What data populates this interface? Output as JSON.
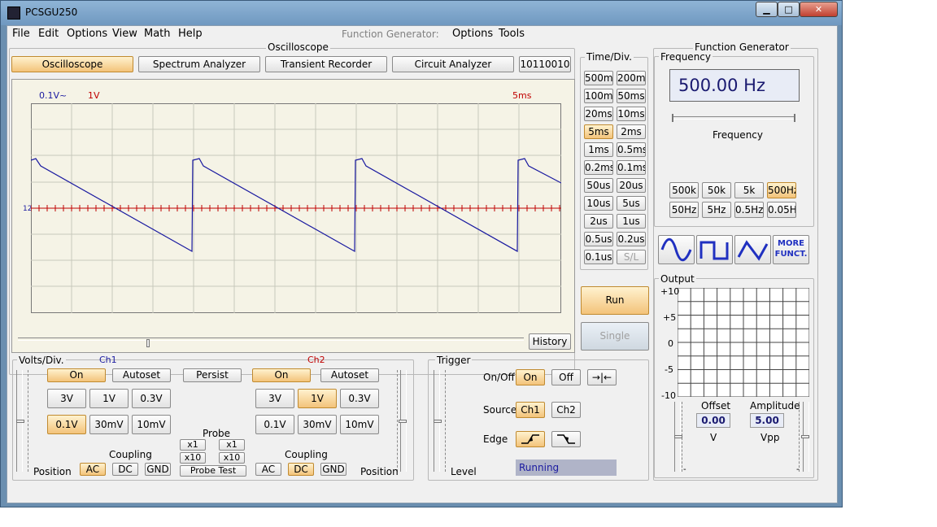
{
  "window": {
    "title": "PCSGU250",
    "min": "▁",
    "max": "□",
    "close": "✕"
  },
  "menu": {
    "file": "File",
    "edit": "Edit",
    "options": "Options",
    "view": "View",
    "math": "Math",
    "help": "Help",
    "fg_label": "Function Generator:",
    "fg_options": "Options",
    "fg_tools": "Tools"
  },
  "osc": {
    "group_title": "Oscilloscope",
    "tabs": [
      "Oscilloscope",
      "Spectrum Analyzer",
      "Transient Recorder",
      "Circuit Analyzer",
      "10110010"
    ],
    "screen": {
      "ch1_range": "0.1V~",
      "ch2_range": "1V",
      "timebase": "5ms",
      "marker": "12"
    },
    "history": "History"
  },
  "colors": {
    "ch1": "#1a1aa0",
    "ch2": "#c00000",
    "active_btn": "#f3c37a",
    "screen_bg": "#f5f3e6",
    "grid": "#c8c8bc"
  },
  "timediv": {
    "title": "Time/Div.",
    "buttons": [
      [
        "500ms",
        "200ms"
      ],
      [
        "100ms",
        "50ms"
      ],
      [
        "20ms",
        "10ms"
      ],
      [
        "5ms",
        "2ms"
      ],
      [
        "1ms",
        "0.5ms"
      ],
      [
        "0.2ms",
        "0.1ms"
      ],
      [
        "50us",
        "20us"
      ],
      [
        "10us",
        "5us"
      ],
      [
        "2us",
        "1us"
      ],
      [
        "0.5us",
        "0.2us"
      ],
      [
        "0.1us",
        "S/L"
      ]
    ],
    "active": "5ms",
    "disabled": "S/L"
  },
  "run": {
    "run": "Run",
    "single": "Single"
  },
  "volts": {
    "title": "Volts/Div.",
    "ch1": "Ch1",
    "ch2": "Ch2",
    "on": "On",
    "autoset": "Autoset",
    "persist": "Persist",
    "ranges_row1": [
      "3V",
      "1V",
      "0.3V"
    ],
    "ranges_row2": [
      "0.1V",
      "30mV",
      "10mV"
    ],
    "ch1_active": "0.1V",
    "ch2_active": "1V",
    "probe": "Probe",
    "x1": "x1",
    "x10": "x10",
    "probe_test": "Probe Test",
    "coupling": "Coupling",
    "ac": "AC",
    "dc": "DC",
    "gnd": "GND",
    "position": "Position",
    "ch1_coupling": "AC",
    "ch2_coupling": "DC"
  },
  "trigger": {
    "title": "Trigger",
    "onoff": "On/Off",
    "on": "On",
    "off": "Off",
    "source": "Source",
    "ch1": "Ch1",
    "ch2": "Ch2",
    "edge": "Edge",
    "level": "Level",
    "status": "Running",
    "center_icon": "→|←"
  },
  "fg": {
    "title": "Function Generator",
    "freq_title": "Frequency",
    "freq_value": "500.00 Hz",
    "freq_slider_label": "Frequency",
    "ranges": [
      [
        "500k",
        "50k",
        "5k",
        "500Hz"
      ],
      [
        "50Hz",
        "5Hz",
        "0.5Hz",
        "0.05Hz"
      ]
    ],
    "active": "500Hz",
    "more": "MORE FUNCT.",
    "output": "Output",
    "y_labels": [
      "+10",
      "+5",
      "0",
      "-5",
      "-10"
    ],
    "offset_label": "Offset",
    "offset": "0.00",
    "offset_unit": "V",
    "amp_label": "Amplitude",
    "amp": "5.00",
    "amp_unit": "Vpp",
    "minus": "-"
  }
}
